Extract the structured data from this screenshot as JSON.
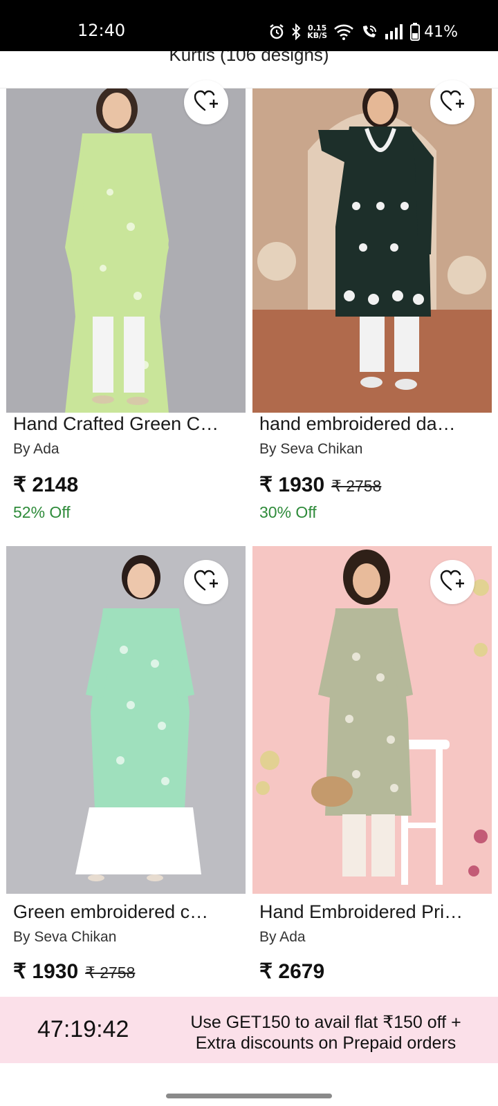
{
  "status_bar": {
    "time": "12:40",
    "net_speed_value": "0.15",
    "net_speed_unit": "KB/S",
    "battery": "41%",
    "icons": [
      "alarm-icon",
      "bluetooth-icon",
      "wifi-icon",
      "wifi-calling-icon",
      "signal-icon",
      "battery-icon"
    ]
  },
  "header": {
    "title": "Kurtis (106 designs)"
  },
  "products": [
    {
      "title": "Hand Crafted Green C…",
      "brand": "By Ada",
      "price": "₹ 2148",
      "mrp": "",
      "discount": "52% Off",
      "image_colors": {
        "bg": "#a9a9ae",
        "kurta": "#c9e59a",
        "bottom": "#f4f4f4"
      }
    },
    {
      "title": "hand embroidered da…",
      "brand": "By Seva Chikan",
      "price": "₹ 1930",
      "mrp": "₹ 2758",
      "discount": "30% Off",
      "image_colors": {
        "bg": "#b8876a",
        "kurta": "#1d2f2a",
        "bottom": "#f2f2f2"
      }
    },
    {
      "title": "Green embroidered c…",
      "brand": "By Seva Chikan",
      "price": "₹ 1930",
      "mrp": "₹ 2758",
      "discount": "",
      "image_colors": {
        "bg": "#bdbdc2",
        "kurta": "#9fe0bd",
        "bottom": "#ffffff"
      }
    },
    {
      "title": "Hand Embroidered Pri…",
      "brand": "By Ada",
      "price": "₹ 2679",
      "mrp": "",
      "discount": "",
      "image_colors": {
        "bg": "#f6c6c3",
        "kurta": "#b5b99a",
        "bottom": "#f4ece4"
      }
    }
  ],
  "wishlist_icon": "heart-plus-icon",
  "promo": {
    "timer": "47:19:42",
    "line1": "Use GET150 to avail flat ₹150 off +",
    "line2": "Extra discounts on Prepaid orders",
    "bg": "#fbe0e9"
  },
  "colors": {
    "discount_green": "#2e8b3a"
  }
}
